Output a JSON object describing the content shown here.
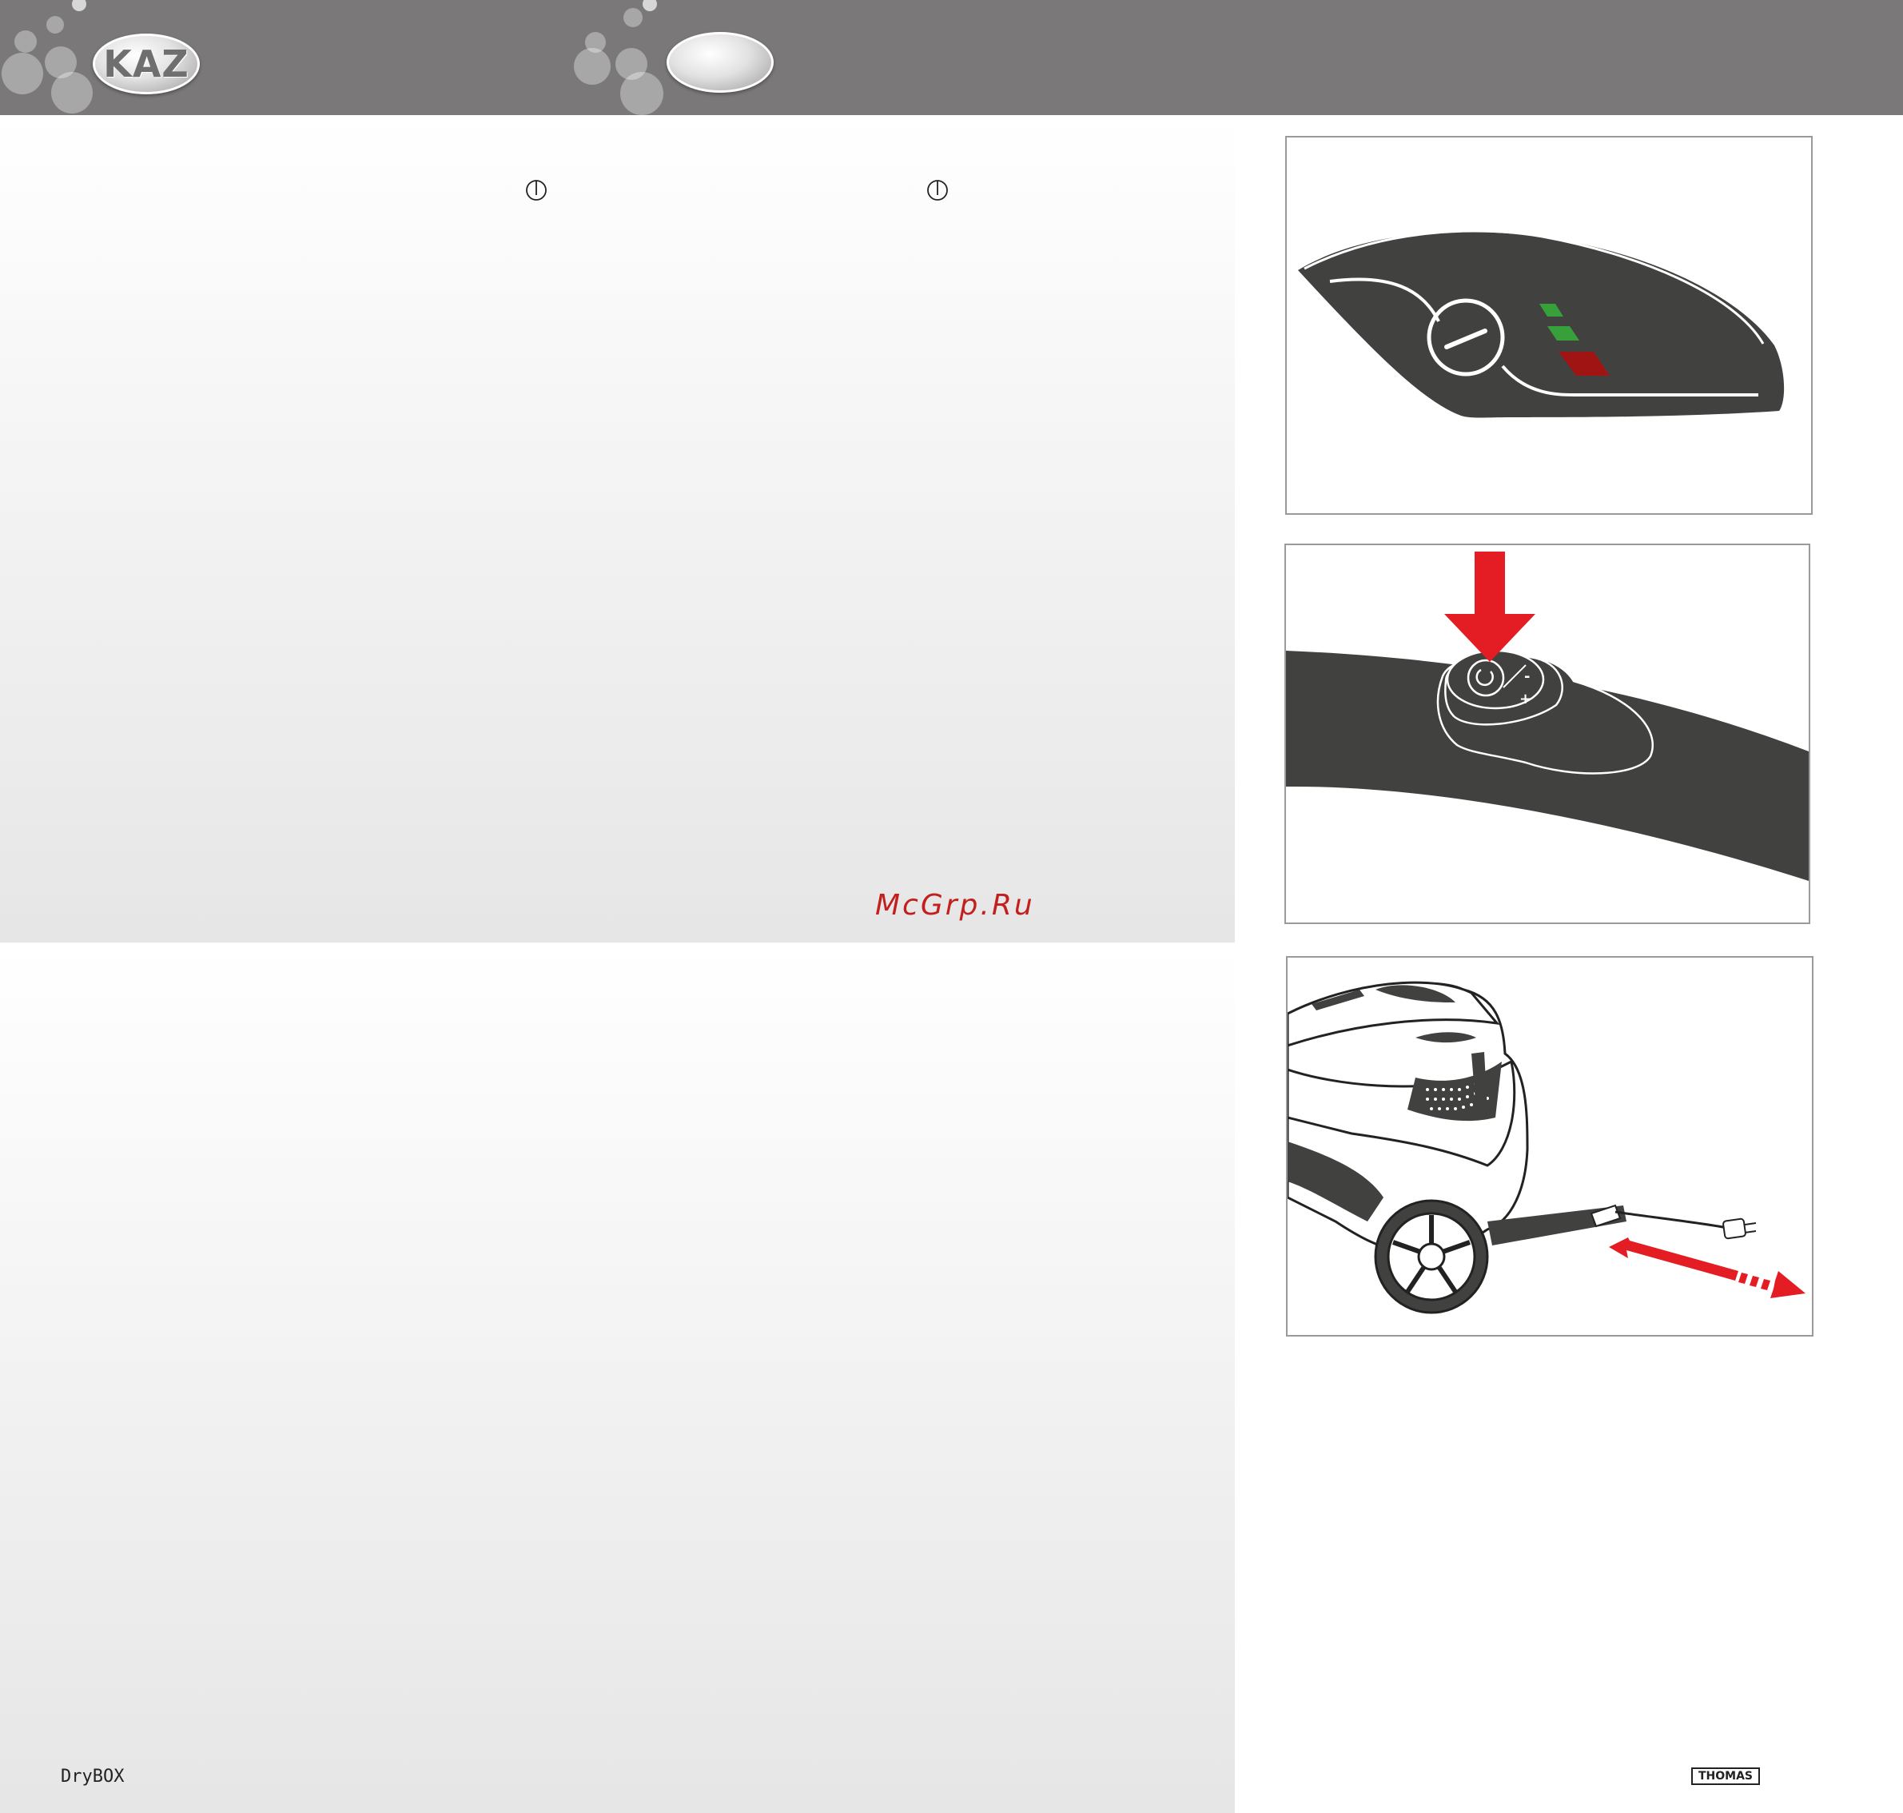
{
  "header": {
    "logo_text": "KAZ",
    "second_logo_text": ""
  },
  "watermark": "McGrp.Ru",
  "footer": {
    "model": "DryBOX",
    "brand": "THOMAS"
  },
  "figures": [
    {
      "name": "control-panel-indicator",
      "indicator_colors": [
        "#38a03a",
        "#38a03a",
        "#a11414"
      ]
    },
    {
      "name": "handle-power-button",
      "button_labels": [
        "-",
        "+"
      ],
      "arrow_color": "#e41d24"
    },
    {
      "name": "vacuum-cord-pull",
      "arrow_color": "#e41d24"
    }
  ],
  "colors": {
    "header": "#7a7879",
    "dark_body": "#414140",
    "accent_red": "#e41d24"
  }
}
